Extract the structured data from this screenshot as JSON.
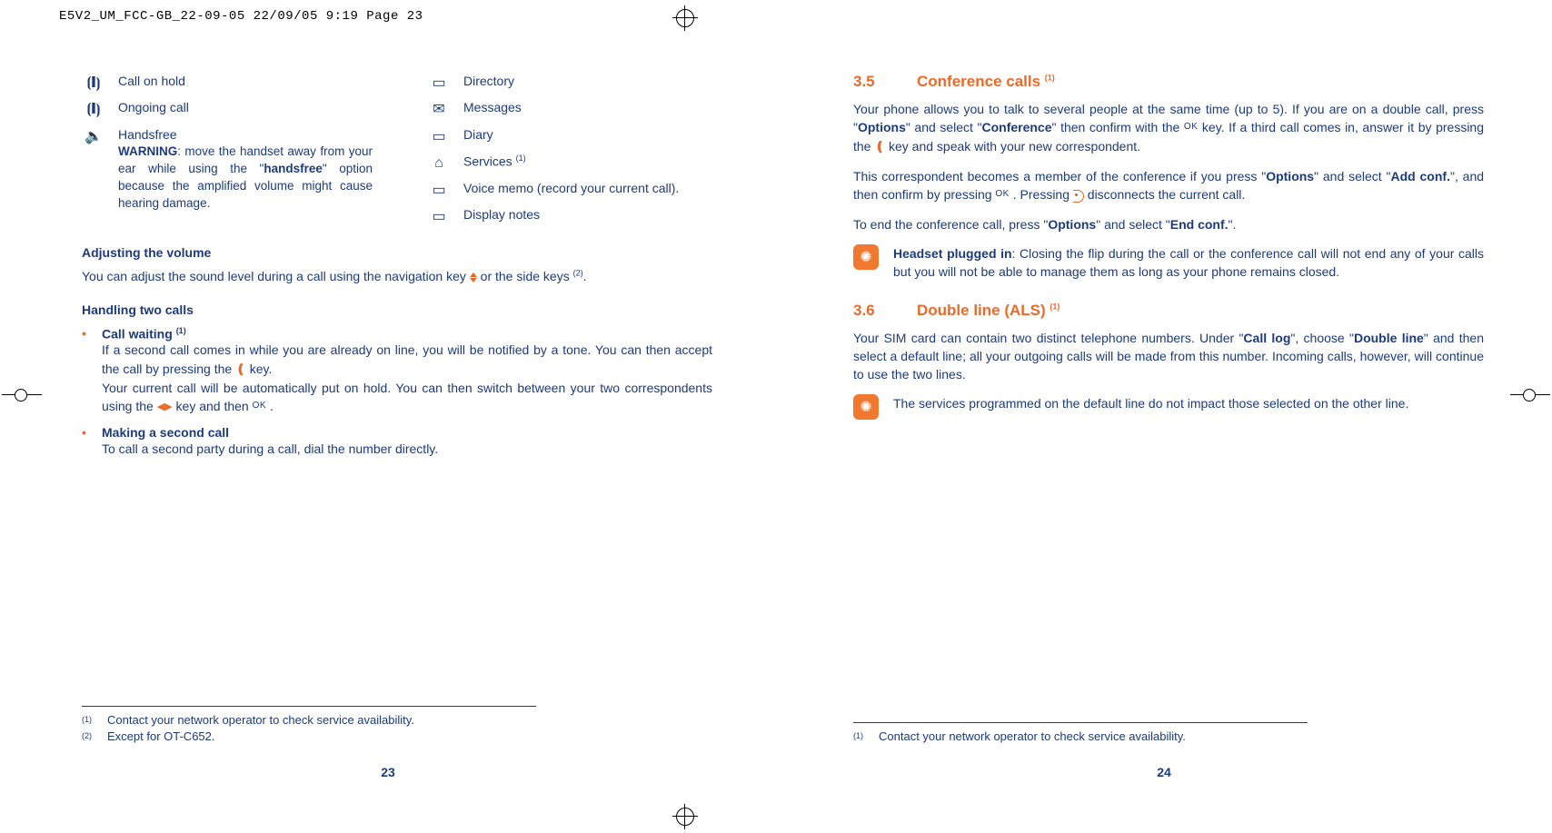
{
  "crop_header": "E5V2_UM_FCC-GB_22-09-05  22/09/05  9:19  Page 23",
  "left": {
    "icons_left": [
      {
        "glyph": "⦗❙⦘",
        "label": "Call on hold"
      },
      {
        "glyph": "⦗❙⦘",
        "label": "Ongoing call"
      },
      {
        "glyph": "🔈",
        "label": "Handsfree"
      }
    ],
    "handsfree_warning_pre": "WARNING",
    "handsfree_warning_body": ": move the handset away from your ear while using the \"",
    "handsfree_warning_em": "handsfree",
    "handsfree_warning_tail": "\" option because the amplified volume might cause hearing damage.",
    "icons_right": [
      {
        "glyph": "▭",
        "label": "Directory"
      },
      {
        "glyph": "✉",
        "label": "Messages"
      },
      {
        "glyph": "▭",
        "label": "Diary"
      },
      {
        "glyph": "⌂",
        "label": "Services ",
        "sup": "(1)"
      },
      {
        "glyph": "▭",
        "label": "Voice memo (record your current call)."
      },
      {
        "glyph": "▭",
        "label": "Display notes"
      }
    ],
    "adjust_title": "Adjusting the volume",
    "adjust_text_a": "You can adjust the sound level during a call using the navigation key ",
    "adjust_text_b": " or the side keys ",
    "adjust_sup": "(2)",
    "handling_title": "Handling two calls",
    "call_waiting_title": "Call waiting ",
    "call_waiting_sup": "(1)",
    "call_waiting_l1a": "If a second call comes in while you are already on line, you will be notified by a tone. You can then accept the call by pressing the ",
    "call_waiting_l1b": " key.",
    "call_waiting_l2a": "Your current call will be automatically put on hold. You can then switch between your two correspondents using the ",
    "call_waiting_l2b": " key and then ",
    "call_waiting_l2c": " .",
    "second_call_title": "Making a second call",
    "second_call_body": "To call a second party during a call, dial the number directly.",
    "fn1": "Contact your network operator to check service availability.",
    "fn2": "Except for OT-C652.",
    "page_no": "23"
  },
  "right": {
    "s35_num": "3.5",
    "s35_title": "Conference calls ",
    "s35_sup": "(1)",
    "s35_p1a": "Your phone allows you to talk to several people at the same time (up to 5). If you are on a double call, press \"",
    "s35_p1b": "Options",
    "s35_p1c": "\" and select \"",
    "s35_p1d": "Conference",
    "s35_p1e": "\" then confirm with the ",
    "s35_p1f": " key. If a third call comes in, answer it by pressing the ",
    "s35_p1g": " key and speak with your new correspondent.",
    "s35_p2a": "This correspondent becomes a member of the conference if you press \"",
    "s35_p2b": "Options",
    "s35_p2c": "\" and select \"",
    "s35_p2d": "Add conf.",
    "s35_p2e": "\", and then confirm by pressing ",
    "s35_p2f": " . Pressing ",
    "s35_p2g": " disconnects the current call.",
    "s35_p3a": "To end the conference call, press \"",
    "s35_p3b": "Options",
    "s35_p3c": "\" and select \"",
    "s35_p3d": "End conf.",
    "s35_p3e": "\".",
    "tip1a": "Headset plugged in",
    "tip1b": ": Closing the flip during the call or the conference call will not end any of your calls but you will not be able to manage them as long as your phone remains closed.",
    "s36_num": "3.6",
    "s36_title": "Double line (ALS) ",
    "s36_sup": "(1)",
    "s36_p1a": "Your SIM card can contain two distinct telephone numbers. Under \"",
    "s36_p1b": "Call log",
    "s36_p1c": "\", choose \"",
    "s36_p1d": "Double line",
    "s36_p1e": "\" and then select a default line; all your outgoing calls will be made from this number. Incoming calls, however, will continue to use the two lines.",
    "tip2": "The services programmed on the default line do not impact those selected on the other line.",
    "fn1": "Contact your network operator to check service availability.",
    "page_no": "24"
  }
}
